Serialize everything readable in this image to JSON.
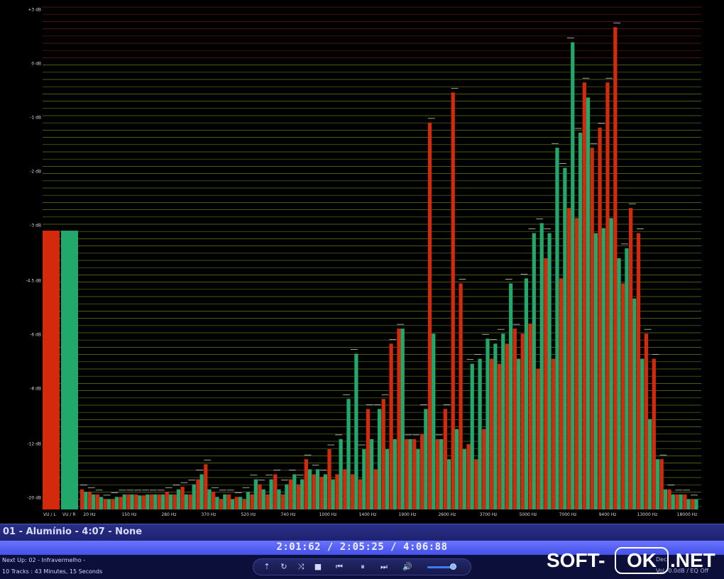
{
  "analyzer": {
    "db_labels": [
      "+3 dB",
      "0 dB",
      "-1 dB",
      "-2 dB",
      "-3 dB",
      "-4.5 dB",
      "-6 dB",
      "-8 dB",
      "-12 dB",
      "-20 dB"
    ],
    "vu_labels": [
      "VU / L",
      "VU / R"
    ],
    "freq_labels": [
      "20 Hz",
      "150 Hz",
      "280 Hz",
      "370 Hz",
      "520 Hz",
      "740 Hz",
      "1000 Hz",
      "1400 Hz",
      "1900 Hz",
      "2600 Hz",
      "3700 Hz",
      "5000 Hz",
      "7000 Hz",
      "9400 Hz",
      "13000 Hz",
      "18000 Hz"
    ],
    "vu_levels": [
      0.555,
      0.555
    ],
    "bands_left": [
      0.04,
      0.035,
      0.03,
      0.02,
      0.02,
      0.025,
      0.03,
      0.03,
      0.028,
      0.03,
      0.03,
      0.035,
      0.03,
      0.045,
      0.03,
      0.06,
      0.09,
      0.035,
      0.02,
      0.03,
      0.025,
      0.02,
      0.03,
      0.05,
      0.03,
      0.07,
      0.03,
      0.06,
      0.05,
      0.1,
      0.07,
      0.065,
      0.12,
      0.07,
      0.08,
      0.07,
      0.06,
      0.2,
      0.08,
      0.22,
      0.33,
      0.36,
      0.14,
      0.14,
      0.15,
      0.77,
      0.14,
      0.2,
      0.83,
      0.45,
      0.13,
      0.1,
      0.16,
      0.3,
      0.29,
      0.33,
      0.36,
      0.35,
      0.37,
      0.28,
      0.5,
      0.3,
      0.46,
      0.6,
      0.58,
      0.85,
      0.72,
      0.76,
      0.85,
      0.96,
      0.45,
      0.6,
      0.55,
      0.35,
      0.3,
      0.1,
      0.04,
      0.03,
      0.03,
      0.02
    ],
    "bands_right": [
      0.035,
      0.03,
      0.025,
      0.02,
      0.025,
      0.03,
      0.03,
      0.028,
      0.03,
      0.03,
      0.03,
      0.03,
      0.04,
      0.03,
      0.05,
      0.07,
      0.04,
      0.025,
      0.03,
      0.02,
      0.025,
      0.035,
      0.06,
      0.04,
      0.06,
      0.04,
      0.05,
      0.07,
      0.06,
      0.08,
      0.08,
      0.07,
      0.06,
      0.14,
      0.22,
      0.31,
      0.12,
      0.14,
      0.2,
      0.12,
      0.14,
      0.36,
      0.14,
      0.12,
      0.2,
      0.35,
      0.14,
      0.1,
      0.16,
      0.12,
      0.29,
      0.3,
      0.34,
      0.33,
      0.35,
      0.45,
      0.3,
      0.46,
      0.55,
      0.57,
      0.55,
      0.72,
      0.68,
      0.93,
      0.75,
      0.82,
      0.55,
      0.56,
      0.58,
      0.5,
      0.52,
      0.42,
      0.3,
      0.18,
      0.1,
      0.04,
      0.03,
      0.03,
      0.02,
      0.02
    ],
    "colors": {
      "left": "#d42a0c",
      "right": "#22a86a",
      "grid": "#5a7a1a",
      "grid_top": "#6a1a10"
    }
  },
  "now_playing": {
    "title": "01 - Alumínio - 4:07 - None",
    "time": "2:01:62 / 2:05:25 / 4:06:88"
  },
  "status": {
    "next_up": "Next Up: 02 - Infravermelho -",
    "track_count": "10 Tracks : 43 Minutes, 15 Seconds",
    "right_1": "Dec",
    "right_2": "Vol -0.0dB / EQ Off"
  },
  "controls": {
    "up": "⇡",
    "repeat": "↻",
    "shuffle": "⤨",
    "stop": "■",
    "prev": "⏮",
    "pause": "⏸",
    "next": "⏭",
    "volume": "🔊",
    "volume_level": 0.9
  },
  "watermark": {
    "left": "SOFT-",
    "mid": "OK",
    "right": ".NET"
  }
}
